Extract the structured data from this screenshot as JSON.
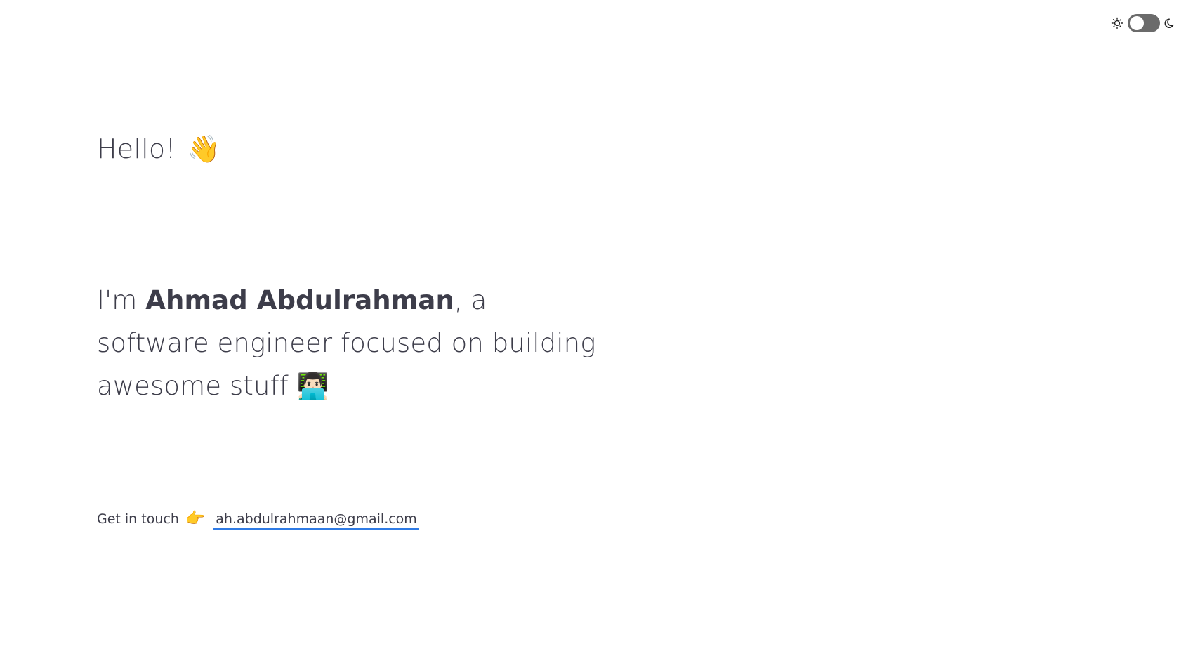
{
  "theme_toggle": {
    "light_icon": "sun-icon",
    "dark_icon": "moon-icon",
    "is_dark": false
  },
  "hero": {
    "greeting": "Hello!",
    "greeting_emoji": "👋",
    "intro_prefix": "I'm ",
    "name": "Ahmad Abdulrahman",
    "intro_suffix": ", a software engineer focused on building awesome stuff",
    "intro_emoji": "👨🏻‍💻"
  },
  "contact": {
    "label": "Get in touch",
    "pointer_emoji": "👉",
    "email": "ah.abdulrahmaan@gmail.com",
    "email_href": "mailto:ah.abdulrahmaan@gmail.com"
  },
  "colors": {
    "text": "#3d3d4a",
    "link_underline": "#2f7be5",
    "toggle_track": "#6b6b6b",
    "background": "#ffffff"
  }
}
